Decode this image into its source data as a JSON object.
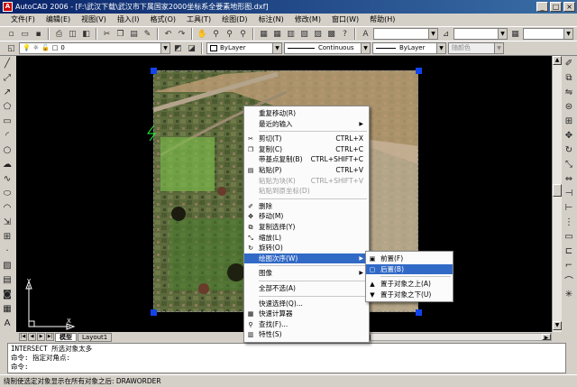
{
  "window": {
    "title": "AutoCAD 2006 - [F:\\武汉下载\\武汉市下属国家2000坐标系全要素地形图.dxf]",
    "app_icon": "A"
  },
  "menubar": [
    "文件(F)",
    "编辑(E)",
    "视图(V)",
    "插入(I)",
    "格式(O)",
    "工具(T)",
    "绘图(D)",
    "标注(N)",
    "修改(M)",
    "窗口(W)",
    "帮助(H)"
  ],
  "properties": {
    "layer": "0",
    "color": "ByLayer",
    "linetype": "Continuous",
    "lineweight": "ByLayer",
    "plotstyle": "随颜色"
  },
  "layout_tabs": [
    "模型",
    "Layout1"
  ],
  "command_lines": [
    "INTERSECT 所选对象太多",
    "命令: 指定对角点:",
    "命令:"
  ],
  "status_hint": "绕制使选定对象显示在所有对象之后:  DRAWORDER",
  "context_menu": {
    "items": [
      {
        "label": "重复移动(R)",
        "shortcut": "",
        "icon": "",
        "disabled": false,
        "submenu": false
      },
      {
        "label": "最近的输入",
        "shortcut": "",
        "icon": "",
        "disabled": false,
        "submenu": true
      },
      {
        "sep": true
      },
      {
        "label": "剪切(T)",
        "shortcut": "CTRL+X",
        "icon": "scissors-icon",
        "disabled": false,
        "submenu": false
      },
      {
        "label": "复制(C)",
        "shortcut": "CTRL+C",
        "icon": "copy-icon",
        "disabled": false,
        "submenu": false
      },
      {
        "label": "带基点复制(B)",
        "shortcut": "CTRL+SHIFT+C",
        "icon": "",
        "disabled": false,
        "submenu": false
      },
      {
        "label": "粘贴(P)",
        "shortcut": "CTRL+V",
        "icon": "paste-icon",
        "disabled": false,
        "submenu": false
      },
      {
        "label": "粘贴为块(K)",
        "shortcut": "CTRL+SHIFT+V",
        "icon": "",
        "disabled": true,
        "submenu": false
      },
      {
        "label": "粘贴到原坐标(D)",
        "shortcut": "",
        "icon": "",
        "disabled": true,
        "submenu": false
      },
      {
        "sep": true
      },
      {
        "label": "删除",
        "shortcut": "",
        "icon": "erase-icon",
        "disabled": false,
        "submenu": false
      },
      {
        "label": "移动(M)",
        "shortcut": "",
        "icon": "move-icon",
        "disabled": false,
        "submenu": false
      },
      {
        "label": "复制选择(Y)",
        "shortcut": "",
        "icon": "copy-select-icon",
        "disabled": false,
        "submenu": false
      },
      {
        "label": "缩放(L)",
        "shortcut": "",
        "icon": "scale-icon",
        "disabled": false,
        "submenu": false
      },
      {
        "label": "旋转(O)",
        "shortcut": "",
        "icon": "rotate-icon",
        "disabled": false,
        "submenu": false
      },
      {
        "label": "绘图次序(W)",
        "shortcut": "",
        "icon": "",
        "disabled": false,
        "submenu": true,
        "highlighted": true
      },
      {
        "sep": true
      },
      {
        "label": "图像",
        "shortcut": "",
        "icon": "",
        "disabled": false,
        "submenu": true
      },
      {
        "sep": true
      },
      {
        "label": "全部不选(A)",
        "shortcut": "",
        "icon": "",
        "disabled": false,
        "submenu": false
      },
      {
        "sep": true
      },
      {
        "label": "快速选择(Q)...",
        "shortcut": "",
        "icon": "",
        "disabled": false,
        "submenu": false
      },
      {
        "label": "快速计算器",
        "shortcut": "",
        "icon": "calculator-icon",
        "disabled": false,
        "submenu": false
      },
      {
        "label": "查找(F)...",
        "shortcut": "",
        "icon": "find-icon",
        "disabled": false,
        "submenu": false
      },
      {
        "label": "特性(S)",
        "shortcut": "",
        "icon": "properties-icon",
        "disabled": false,
        "submenu": false
      }
    ]
  },
  "submenu": {
    "items": [
      {
        "label": "前置(F)",
        "icon": "bring-front-icon",
        "highlighted": false
      },
      {
        "label": "后置(B)",
        "icon": "send-back-icon",
        "highlighted": true
      },
      {
        "sep": true
      },
      {
        "label": "置于对象之上(A)",
        "icon": "above-object-icon",
        "highlighted": false
      },
      {
        "label": "置于对象之下(U)",
        "icon": "under-object-icon",
        "highlighted": false
      }
    ]
  },
  "ucs": {
    "x": "X",
    "y": "Y"
  },
  "colors": {
    "highlight": "#3169c6",
    "canvas": "#000000",
    "grip": "#1144ee"
  }
}
